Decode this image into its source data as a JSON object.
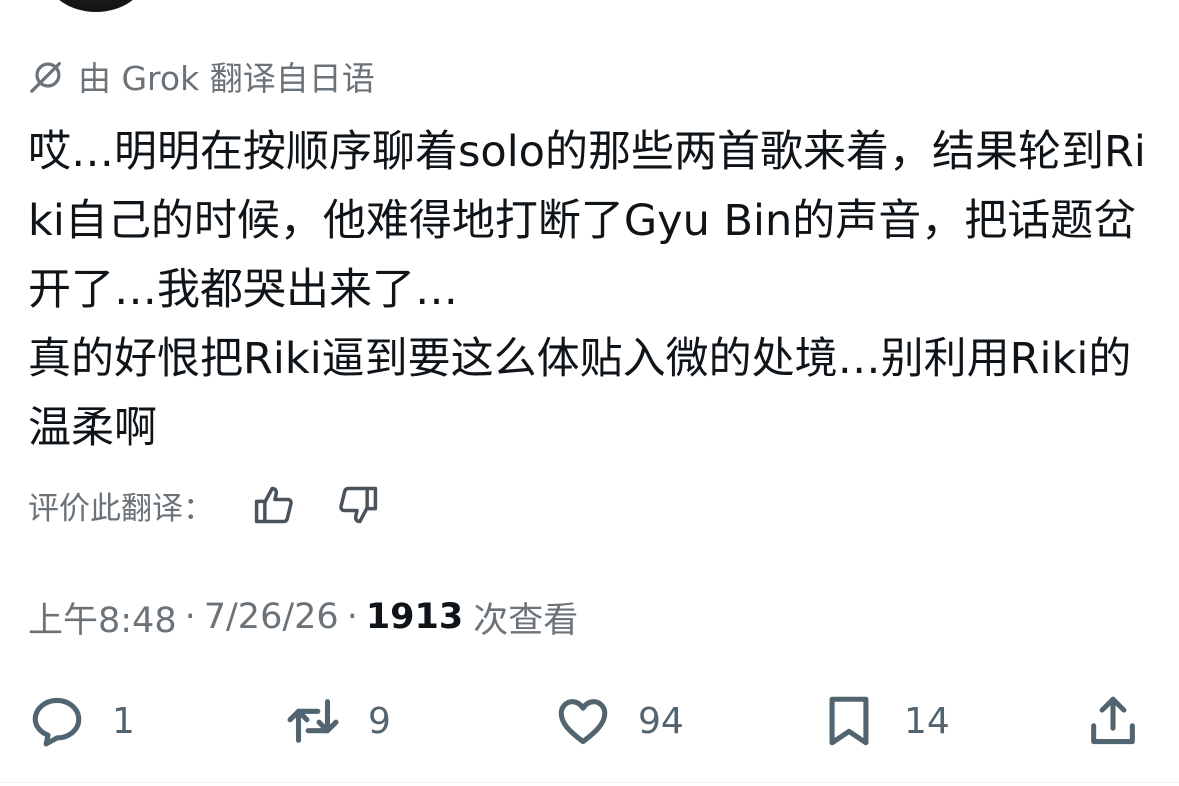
{
  "translation": {
    "label": "由 Grok 翻译自日语",
    "icon": "grok-icon"
  },
  "tweet": {
    "text": "哎…明明在按顺序聊着solo的那些两首歌来着，结果轮到Riki自己的时候，他难得地打断了Gyu Bin的声音，把话题岔开了…我都哭出来了…\n真的好恨把Riki逼到要这么体贴入微的处境…别利用Riki的温柔啊"
  },
  "rate_translation": {
    "label": "评价此翻译：",
    "thumbs_up_icon": "thumbs-up-icon",
    "thumbs_down_icon": "thumbs-down-icon"
  },
  "meta": {
    "time": "上午8:48",
    "separator": "·",
    "date": "7/26/26",
    "views_count": "1913",
    "views_label": "次查看"
  },
  "actions": {
    "replies": {
      "icon": "reply-icon",
      "count": "1"
    },
    "reposts": {
      "icon": "repost-icon",
      "count": "9"
    },
    "likes": {
      "icon": "heart-icon",
      "count": "94"
    },
    "bookmarks": {
      "icon": "bookmark-icon",
      "count": "14"
    },
    "share": {
      "icon": "share-icon"
    }
  },
  "colors": {
    "text": "#0f1419",
    "secondary": "#6b7379",
    "action_icon": "#536471"
  }
}
